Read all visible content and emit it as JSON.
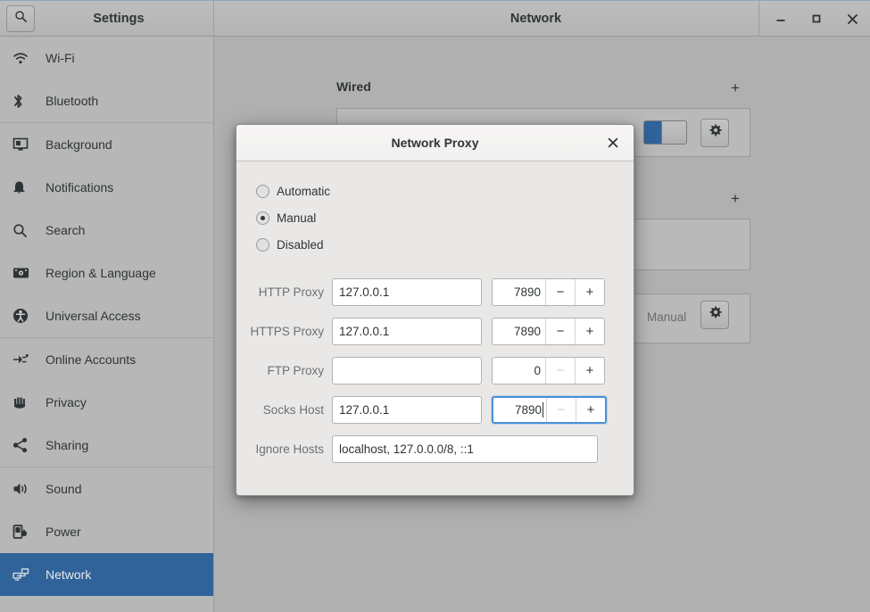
{
  "window": {
    "settings_title": "Settings",
    "panel_title": "Network",
    "search_icon": "search-icon",
    "minimize_label": "–",
    "maximize_label": "□",
    "close_label": "✕"
  },
  "sidebar": {
    "items": [
      {
        "label": "Wi-Fi",
        "icon": "wifi-icon",
        "selected": false
      },
      {
        "label": "Bluetooth",
        "icon": "bluetooth-icon",
        "selected": false
      },
      {
        "label": "Background",
        "icon": "background-icon",
        "selected": false
      },
      {
        "label": "Notifications",
        "icon": "bell-icon",
        "selected": false
      },
      {
        "label": "Search",
        "icon": "search-icon",
        "selected": false
      },
      {
        "label": "Region & Language",
        "icon": "keyboard-icon",
        "selected": false
      },
      {
        "label": "Universal Access",
        "icon": "accessibility-icon",
        "selected": false
      },
      {
        "label": "Online Accounts",
        "icon": "plug-icon",
        "selected": false
      },
      {
        "label": "Privacy",
        "icon": "hand-icon",
        "selected": false
      },
      {
        "label": "Sharing",
        "icon": "share-icon",
        "selected": false
      },
      {
        "label": "Sound",
        "icon": "speaker-icon",
        "selected": false
      },
      {
        "label": "Power",
        "icon": "battery-icon",
        "selected": false
      },
      {
        "label": "Network",
        "icon": "network-icon",
        "selected": true
      }
    ],
    "separator_after": [
      1,
      6,
      9
    ]
  },
  "network_panel": {
    "wired_section_label": "Wired",
    "wired_add_label": "+",
    "vpn_add_label": "+",
    "proxy_value_label": "Manual",
    "gear_icon": "gear-icon",
    "wired_toggle_on": true
  },
  "dialog": {
    "title": "Network Proxy",
    "close_label": "✕",
    "modes": [
      {
        "label": "Automatic",
        "selected": false
      },
      {
        "label": "Manual",
        "selected": true
      },
      {
        "label": "Disabled",
        "selected": false
      }
    ],
    "fields": [
      {
        "label": "HTTP Proxy",
        "host": "127.0.0.1",
        "host_placeholder": "",
        "port": "7890",
        "minus_label": "−",
        "plus_label": "+",
        "minus_dim": false,
        "focused": false
      },
      {
        "label": "HTTPS Proxy",
        "host": "127.0.0.1",
        "host_placeholder": "",
        "port": "7890",
        "minus_label": "−",
        "plus_label": "+",
        "minus_dim": false,
        "focused": false
      },
      {
        "label": "FTP Proxy",
        "host": "",
        "host_placeholder": "",
        "port": "0",
        "minus_label": "−",
        "plus_label": "+",
        "minus_dim": true,
        "focused": false
      },
      {
        "label": "Socks Host",
        "host": "127.0.0.1",
        "host_placeholder": "",
        "port": "7890",
        "minus_label": "−",
        "plus_label": "+",
        "minus_dim": true,
        "focused": true
      }
    ],
    "ignore": {
      "label": "Ignore Hosts",
      "value": "localhost, 127.0.0.0/8, ::1",
      "placeholder": ""
    }
  },
  "colors": {
    "selection": "#2f6399",
    "toggle_on": "#2f6399",
    "focus_ring": "#4a90d9",
    "window_bg": "#b0b0b0",
    "sidebar_bg": "#b7b7b7",
    "dialog_bg": "#e9e8e7"
  }
}
